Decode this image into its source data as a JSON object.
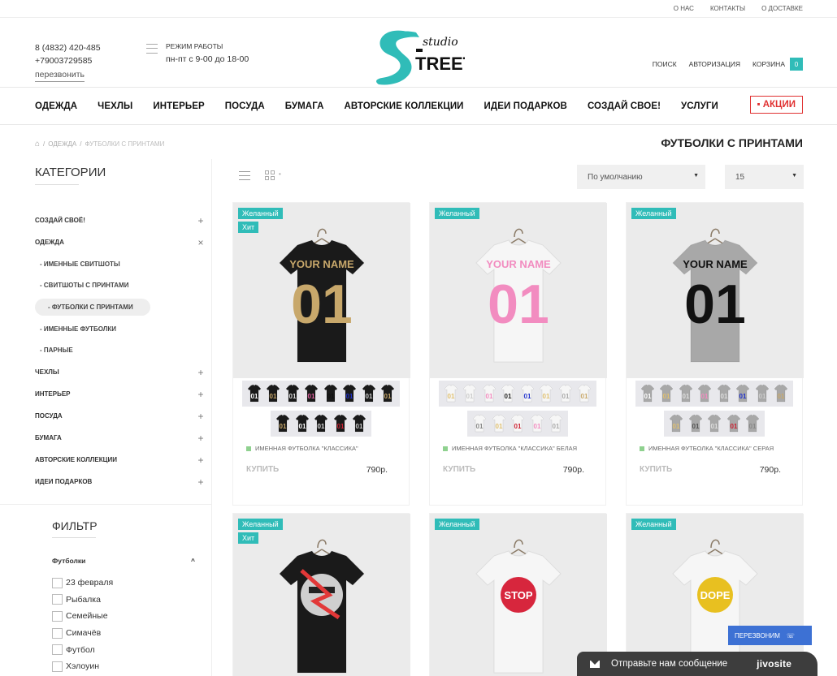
{
  "topbar": {
    "links": [
      "О НАС",
      "КОНТАКТЫ",
      "О ДОСТАВКЕ"
    ]
  },
  "header": {
    "phone1": "8 (4832) 420-485",
    "phone2": "+79003729585",
    "callback": "перезвонить",
    "hours_title": "РЕЖИМ РАБОТЫ",
    "hours_value": "пн-пт с 9-00 до 18-00",
    "logo_top": "studio",
    "logo_main": "TREET",
    "search": "ПОИСК",
    "auth": "АВТОРИЗАЦИЯ",
    "cart": "КОРЗИНА",
    "cart_count": "0"
  },
  "nav": {
    "items": [
      "ОДЕЖДА",
      "ЧЕХЛЫ",
      "ИНТЕРЬЕР",
      "ПОСУДА",
      "БУМАГА",
      "АВТОРСКИЕ КОЛЛЕКЦИИ",
      "ИДЕИ ПОДАРКОВ",
      "СОЗДАЙ СВОЕ!",
      "УСЛУГИ"
    ],
    "promo": "АКЦИИ"
  },
  "breadcrumb": {
    "sep": "/",
    "level1": "ОДЕЖДА",
    "current": "ФУТБОЛКИ С ПРИНТАМИ"
  },
  "page_title": "ФУТБОЛКИ С ПРИНТАМИ",
  "sidebar": {
    "title": "КАТЕГОРИИ",
    "items": [
      {
        "label": "СОЗДАЙ СВОЁ!",
        "sign": "+"
      },
      {
        "label": "ОДЕЖДА",
        "sign": "×"
      }
    ],
    "subitems": [
      "- ИМЕННЫЕ СВИТШОТЫ",
      "- СВИТШОТЫ С ПРИНТАМИ",
      "- ФУТБОЛКИ С ПРИНТАМИ",
      "- ИМЕННЫЕ ФУТБОЛКИ",
      "- ПАРНЫЕ"
    ],
    "items2": [
      {
        "label": "ЧЕХЛЫ",
        "sign": "+"
      },
      {
        "label": "ИНТЕРЬЕР",
        "sign": "+"
      },
      {
        "label": "ПОСУДА",
        "sign": "+"
      },
      {
        "label": "БУМАГА",
        "sign": "+"
      },
      {
        "label": "АВТОРСКИЕ КОЛЛЕКЦИИ",
        "sign": "+"
      },
      {
        "label": "ИДЕИ ПОДАРКОВ",
        "sign": "+"
      }
    ],
    "filter_title": "ФИЛЬТР",
    "filter_group": "Футболки",
    "filter_group_sign": "^",
    "filter_options": [
      "23 февраля",
      "Рыбалка",
      "Семейные",
      "Симачёв",
      "Футбол",
      "Хэлоуин"
    ]
  },
  "toolbar": {
    "sort": "По умолчанию",
    "per_page": "15"
  },
  "products": [
    {
      "badges": [
        "Желанный",
        "Хит"
      ],
      "name": "ИМЕННАЯ ФУТБОЛКА \"КЛАССИКА\"",
      "buy": "КУПИТЬ",
      "price": "790р.",
      "shirt_color": "#1a1a1a",
      "print_color": "#c8a86b",
      "print_name": "YOUR NAME",
      "print_num": "01"
    },
    {
      "badges": [
        "Желанный"
      ],
      "name": "ИМЕННАЯ ФУТБОЛКА \"КЛАССИКА\" БЕЛАЯ",
      "buy": "КУПИТЬ",
      "price": "790р.",
      "shirt_color": "#f6f6f6",
      "print_color": "#f28cc0",
      "print_name": "YOUR NAME",
      "print_num": "01"
    },
    {
      "badges": [
        "Желанный"
      ],
      "name": "ИМЕННАЯ ФУТБОЛКА \"КЛАССИКА\" СЕРАЯ",
      "buy": "КУПИТЬ",
      "price": "790р.",
      "shirt_color": "#a8a8a8",
      "print_color": "#111111",
      "print_name": "YOUR NAME",
      "print_num": "01"
    },
    {
      "badges": [
        "Желанный",
        "Хит"
      ],
      "shirt_color": "#1a1a1a"
    },
    {
      "badges": [
        "Желанный"
      ],
      "shirt_color": "#f6f6f6",
      "print_text": "STOP"
    },
    {
      "badges": [
        "Желанный"
      ],
      "shirt_color": "#f6f6f6",
      "print_text": "DOPE"
    }
  ],
  "thumbs": [
    {
      "rows": [
        [
          "#1a1a1a",
          "#1a1a1a",
          "#1a1a1a",
          "#1a1a1a",
          "#1a1a1a",
          "#1a1a1a",
          "#1a1a1a",
          "#1a1a1a"
        ],
        [
          "#1a1a1a",
          "#1a1a1a",
          "#1a1a1a",
          "#1a1a1a",
          "#1a1a1a"
        ]
      ],
      "prints": [
        [
          "#ffffff",
          "#c8a86b",
          "#dddddd",
          "#e060a0",
          "#111111",
          "#2233cc",
          "#cccccc",
          "#c8a86b"
        ],
        [
          "#c8a86b",
          "#ffffff",
          "#dddddd",
          "#cc2233",
          "#cccccc"
        ]
      ]
    },
    {
      "rows": [
        [
          "#f6f6f6",
          "#f6f6f6",
          "#f6f6f6",
          "#f6f6f6",
          "#f6f6f6",
          "#f6f6f6",
          "#f6f6f6",
          "#f6f6f6"
        ],
        [
          "#f6f6f6",
          "#f6f6f6",
          "#f6f6f6",
          "#f6f6f6",
          "#f6f6f6"
        ]
      ],
      "prints": [
        [
          "#e0c070",
          "#cccccc",
          "#f28cc0",
          "#222222",
          "#2233cc",
          "#e0c070",
          "#aaaaaa",
          "#c8a86b"
        ],
        [
          "#888888",
          "#e0c070",
          "#cc2233",
          "#f28cc0",
          "#aaaaaa"
        ]
      ]
    },
    {
      "rows": [
        [
          "#a8a8a8",
          "#a8a8a8",
          "#a8a8a8",
          "#a8a8a8",
          "#a8a8a8",
          "#a8a8a8",
          "#a8a8a8",
          "#a8a8a8"
        ],
        [
          "#a8a8a8",
          "#a8a8a8",
          "#a8a8a8",
          "#a8a8a8",
          "#a8a8a8"
        ]
      ],
      "prints": [
        [
          "#ffffff",
          "#e0c070",
          "#dddddd",
          "#f28cc0",
          "#dddddd",
          "#2233cc",
          "#cccccc",
          "#c8a86b"
        ],
        [
          "#e0c070",
          "#555555",
          "#dddddd",
          "#cc2233",
          "#888888"
        ]
      ]
    }
  ],
  "widgets": {
    "callback": "ПЕРЕЗВОНИМ",
    "chat": "Отправьте нам сообщение",
    "chat_brand": "jivosite"
  },
  "colors": {
    "accent": "#30bcb8",
    "promo": "#e03030",
    "chat_bg": "#3d3d3d",
    "callback_bg": "#3d71d4"
  }
}
